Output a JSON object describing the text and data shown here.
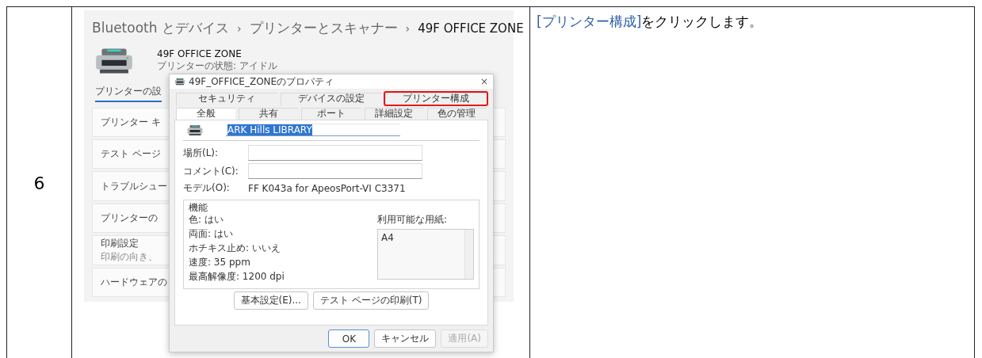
{
  "step": {
    "number": "6"
  },
  "settings": {
    "breadcrumb": [
      {
        "label": "Bluetooth とデバイス",
        "current": false
      },
      {
        "label": "プリンターとスキャナー",
        "current": false
      },
      {
        "label": "49F OFFICE ZONE",
        "current": true
      }
    ],
    "separator": "›",
    "printer": {
      "name": "49F OFFICE ZONE",
      "status": "プリンターの状態: アイドル"
    },
    "section": "プリンターの設",
    "cards": [
      {
        "title": "プリンター キ"
      },
      {
        "title": "テスト ページ"
      },
      {
        "title": "トラブルシュー"
      },
      {
        "title": "プリンターの"
      },
      {
        "title": "印刷設定",
        "subtitle": "印刷の向き、"
      },
      {
        "title": "ハードウェアの"
      }
    ]
  },
  "dialog": {
    "title": "49F_OFFICE_ZONEのプロパティ",
    "close": "×",
    "tab_rows": [
      [
        {
          "label": "セキュリティ",
          "selected": false,
          "highlighted": false
        },
        {
          "label": "デバイスの設定",
          "selected": false,
          "highlighted": false
        },
        {
          "label": "プリンター構成",
          "selected": false,
          "highlighted": true
        }
      ],
      [
        {
          "label": "全般",
          "selected": true,
          "highlighted": false
        },
        {
          "label": "共有",
          "selected": false,
          "highlighted": false
        },
        {
          "label": "ポート",
          "selected": false,
          "highlighted": false
        },
        {
          "label": "詳細設定",
          "selected": false,
          "highlighted": false
        },
        {
          "label": "色の管理",
          "selected": false,
          "highlighted": false
        }
      ]
    ],
    "name_field": {
      "value": "ARK Hills LIBRARY",
      "text_selected": true
    },
    "fields": [
      {
        "label": "場所(L):"
      },
      {
        "label": "コメント(C):"
      }
    ],
    "model": {
      "label": "モデル(O):",
      "value": "FF K043a for ApeosPort-VI C3371"
    },
    "features": {
      "title": "機能",
      "items": [
        "色: はい",
        "両面: はい",
        "ホチキス止め: いいえ",
        "速度: 35 ppm",
        "最高解像度: 1200 dpi"
      ],
      "paper_label": "利用可能な用紙:",
      "papers": [
        "A4"
      ]
    },
    "inner_buttons": [
      {
        "label": "基本設定(E)...",
        "disabled": false,
        "default": false
      },
      {
        "label": "テスト ページの印刷(T)",
        "disabled": false,
        "default": false
      }
    ],
    "buttons": [
      {
        "label": "OK",
        "disabled": false,
        "default": true
      },
      {
        "label": "キャンセル",
        "disabled": false,
        "default": false
      },
      {
        "label": "適用(A)",
        "disabled": true,
        "default": false
      }
    ]
  },
  "instruction": {
    "highlight": "[プリンター構成]",
    "text": "をクリックします。"
  }
}
